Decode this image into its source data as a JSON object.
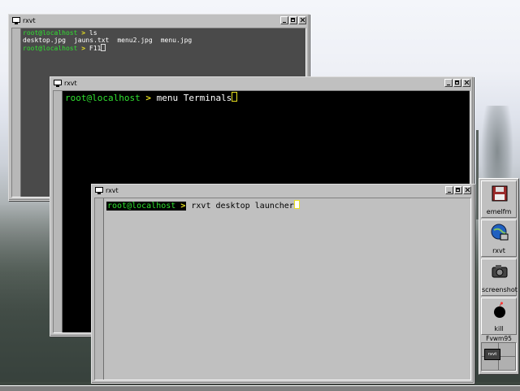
{
  "desktop": {
    "windows": [
      {
        "title": "rxvt",
        "lines": [
          {
            "user": "root@localhost",
            "arrow": ">",
            "cmd": "ls"
          },
          {
            "output": [
              "desktop.jpg",
              "jauns.txt",
              "menu2.jpg",
              "menu.jpg"
            ]
          },
          {
            "user": "root@localhost",
            "arrow": ">",
            "cmd": "F11"
          }
        ]
      },
      {
        "title": "rxvt",
        "lines": [
          {
            "user": "root@localhost",
            "arrow": ">",
            "cmd": "menu Terminals"
          }
        ]
      },
      {
        "title": "rxvt",
        "lines": [
          {
            "user": "root@localhost",
            "arrow": ">",
            "cmd": "rxvt desktop launcher"
          }
        ]
      }
    ]
  },
  "dock": {
    "items": [
      {
        "label": "emelfm",
        "icon": "floppy-disk-icon"
      },
      {
        "label": "rxvt",
        "icon": "globe-monitor-icon"
      },
      {
        "label": "screenshot",
        "icon": "camera-icon"
      },
      {
        "label": "kill",
        "icon": "bomb-icon"
      }
    ],
    "pager_title": "Fvwm95",
    "pager_mini": "rxvt"
  }
}
